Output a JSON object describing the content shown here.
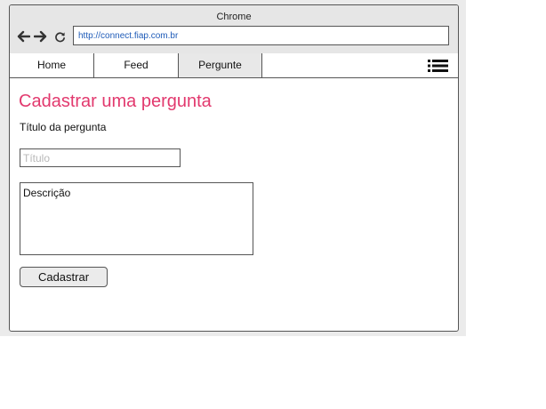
{
  "browser": {
    "title": "Chrome",
    "url": "http://connect.fiap.com.br",
    "icons": {
      "back": "arrow-left-icon",
      "forward": "arrow-right-icon",
      "reload": "reload-icon"
    }
  },
  "nav": {
    "tabs": [
      {
        "label": "Home",
        "active": false
      },
      {
        "label": "Feed",
        "active": false
      },
      {
        "label": "Pergunte",
        "active": true
      }
    ],
    "menu_icon": "list-menu-icon"
  },
  "form": {
    "heading": "Cadastrar uma pergunta",
    "title_label": "Título da pergunta",
    "title_placeholder": "Título",
    "title_value": "",
    "description_placeholder": "Descrição",
    "description_value": "",
    "submit_label": "Cadastrar"
  },
  "colors": {
    "heading": "#e2396e",
    "url_text": "#1e5bb8",
    "active_tab": "#e8e8e8",
    "chrome_bar": "#e6e6e6"
  }
}
